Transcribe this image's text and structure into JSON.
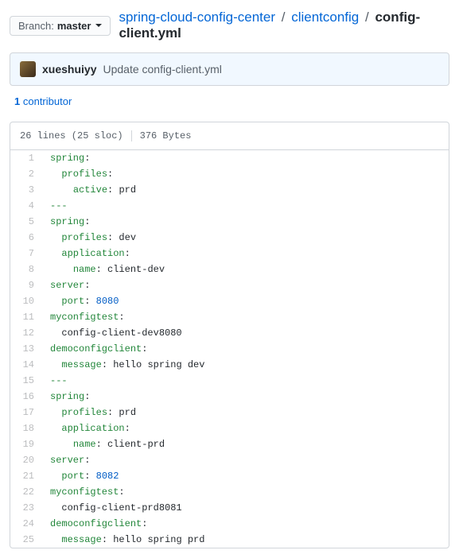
{
  "branch": {
    "label": "Branch:",
    "value": "master"
  },
  "breadcrumb": {
    "root": "spring-cloud-config-center",
    "folder": "clientconfig",
    "file": "config-client.yml"
  },
  "commit": {
    "author": "xueshuiyy",
    "message": "Update config-client.yml"
  },
  "contributors": {
    "count": "1",
    "label": "contributor"
  },
  "file_info": {
    "lines": "26 lines (25 sloc)",
    "size": "376 Bytes"
  },
  "code_lines": [
    {
      "n": 1,
      "tokens": [
        [
          "ent",
          "spring"
        ],
        [
          "s",
          ":"
        ]
      ]
    },
    {
      "n": 2,
      "tokens": [
        [
          "s",
          "  "
        ],
        [
          "ent",
          "profiles"
        ],
        [
          "s",
          ":"
        ]
      ]
    },
    {
      "n": 3,
      "tokens": [
        [
          "s",
          "    "
        ],
        [
          "ent",
          "active"
        ],
        [
          "s",
          ": "
        ],
        [
          "s",
          "prd"
        ]
      ]
    },
    {
      "n": 4,
      "tokens": [
        [
          "ent",
          "---"
        ]
      ]
    },
    {
      "n": 5,
      "tokens": [
        [
          "ent",
          "spring"
        ],
        [
          "s",
          ":"
        ]
      ]
    },
    {
      "n": 6,
      "tokens": [
        [
          "s",
          "  "
        ],
        [
          "ent",
          "profiles"
        ],
        [
          "s",
          ": "
        ],
        [
          "s",
          "dev"
        ]
      ]
    },
    {
      "n": 7,
      "tokens": [
        [
          "s",
          "  "
        ],
        [
          "ent",
          "application"
        ],
        [
          "s",
          ":"
        ]
      ]
    },
    {
      "n": 8,
      "tokens": [
        [
          "s",
          "    "
        ],
        [
          "ent",
          "name"
        ],
        [
          "s",
          ": "
        ],
        [
          "s",
          "client-dev"
        ]
      ]
    },
    {
      "n": 9,
      "tokens": [
        [
          "ent",
          "server"
        ],
        [
          "s",
          ":"
        ]
      ]
    },
    {
      "n": 10,
      "tokens": [
        [
          "s",
          "  "
        ],
        [
          "ent",
          "port"
        ],
        [
          "s",
          ": "
        ],
        [
          "c1",
          "8080"
        ]
      ]
    },
    {
      "n": 11,
      "tokens": [
        [
          "ent",
          "myconfigtest"
        ],
        [
          "s",
          ":"
        ]
      ]
    },
    {
      "n": 12,
      "tokens": [
        [
          "s",
          "  "
        ],
        [
          "s",
          "config-client-dev8080"
        ]
      ]
    },
    {
      "n": 13,
      "tokens": [
        [
          "ent",
          "democonfigclient"
        ],
        [
          "s",
          ":"
        ]
      ]
    },
    {
      "n": 14,
      "tokens": [
        [
          "s",
          "  "
        ],
        [
          "ent",
          "message"
        ],
        [
          "s",
          ": "
        ],
        [
          "s",
          "hello spring dev"
        ]
      ]
    },
    {
      "n": 15,
      "tokens": [
        [
          "ent",
          "---"
        ]
      ]
    },
    {
      "n": 16,
      "tokens": [
        [
          "ent",
          "spring"
        ],
        [
          "s",
          ":"
        ]
      ]
    },
    {
      "n": 17,
      "tokens": [
        [
          "s",
          "  "
        ],
        [
          "ent",
          "profiles"
        ],
        [
          "s",
          ": "
        ],
        [
          "s",
          "prd"
        ]
      ]
    },
    {
      "n": 18,
      "tokens": [
        [
          "s",
          "  "
        ],
        [
          "ent",
          "application"
        ],
        [
          "s",
          ":"
        ]
      ]
    },
    {
      "n": 19,
      "tokens": [
        [
          "s",
          "    "
        ],
        [
          "ent",
          "name"
        ],
        [
          "s",
          ": "
        ],
        [
          "s",
          "client-prd"
        ]
      ]
    },
    {
      "n": 20,
      "tokens": [
        [
          "ent",
          "server"
        ],
        [
          "s",
          ":"
        ]
      ]
    },
    {
      "n": 21,
      "tokens": [
        [
          "s",
          "  "
        ],
        [
          "ent",
          "port"
        ],
        [
          "s",
          ": "
        ],
        [
          "c1",
          "8082"
        ]
      ]
    },
    {
      "n": 22,
      "tokens": [
        [
          "ent",
          "myconfigtest"
        ],
        [
          "s",
          ":"
        ]
      ]
    },
    {
      "n": 23,
      "tokens": [
        [
          "s",
          "  "
        ],
        [
          "s",
          "config-client-prd8081"
        ]
      ]
    },
    {
      "n": 24,
      "tokens": [
        [
          "ent",
          "democonfigclient"
        ],
        [
          "s",
          ":"
        ]
      ]
    },
    {
      "n": 25,
      "tokens": [
        [
          "s",
          "  "
        ],
        [
          "ent",
          "message"
        ],
        [
          "s",
          ": "
        ],
        [
          "s",
          "hello spring prd"
        ]
      ]
    }
  ]
}
